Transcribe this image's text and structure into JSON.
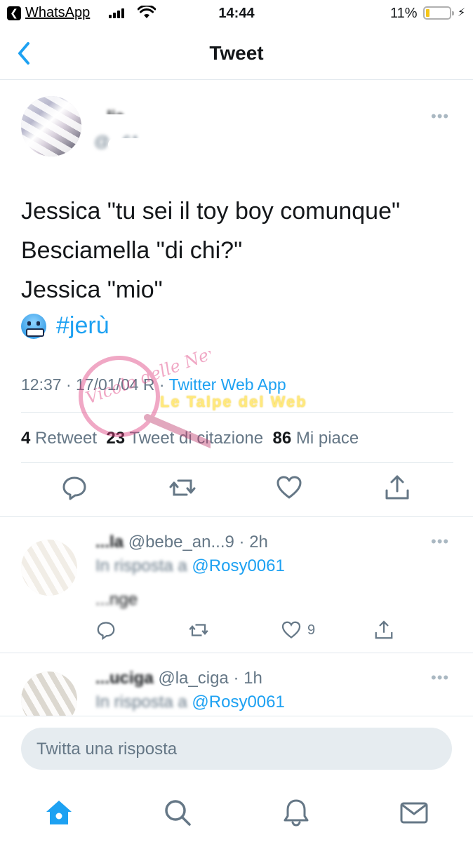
{
  "status_bar": {
    "back_app": "WhatsApp",
    "time": "14:44",
    "battery_percent": "11%",
    "battery_level": 0.11,
    "icons": [
      "back-arrow-icon",
      "signal-icon",
      "wifi-icon",
      "battery-icon",
      "charging-bolt-icon"
    ]
  },
  "nav": {
    "title": "Tweet",
    "back_icon": "chevron-left-icon"
  },
  "tweet": {
    "author_name": "...lia",
    "author_handle": "@...61",
    "lines": [
      "Jessica \"tu sei il toy boy comunque\"",
      "Besciamella \"di chi?\"",
      "Jessica \"mio\""
    ],
    "emoji": "cold-face-emoji",
    "hashtag": "#jerù",
    "time": "12:37 · 17/01/04 R",
    "separator": " · ",
    "source": "Twitter Web App",
    "stats": {
      "retweets_count": "4",
      "retweets_label": "Retweet",
      "quotes_count": "23",
      "quotes_label": "Tweet di citazione",
      "likes_count": "86",
      "likes_label": "Mi piace"
    },
    "more_icon": "more-dots-icon"
  },
  "watermarks": {
    "mark1": "Vicolo delle News",
    "mark2": "Le Talpe del Web"
  },
  "replies": [
    {
      "name": "...la",
      "handle": "@bebe_an...9",
      "age": "· 2h",
      "reply_prefix": "In risposta a",
      "reply_to": "@Rosy0061",
      "text": "...nge",
      "likes": "9"
    },
    {
      "name": "...uciga",
      "handle": "@la_ciga",
      "age": "· 1h",
      "reply_prefix": "In risposta a",
      "reply_to": "@Rosy0061"
    }
  ],
  "composer": {
    "placeholder": "Twitta una risposta"
  },
  "tabbar": {
    "tabs": [
      "home-icon",
      "search-icon",
      "notifications-icon",
      "messages-icon"
    ]
  },
  "colors": {
    "accent": "#1da1f2",
    "text": "#14171a",
    "muted": "#657786",
    "divider": "#e1e8ed"
  }
}
